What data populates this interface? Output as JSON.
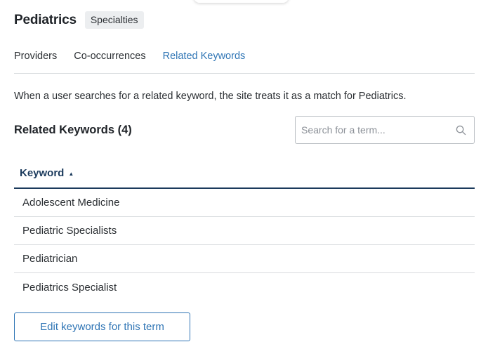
{
  "header": {
    "title": "Pediatrics",
    "badge": "Specialties"
  },
  "tabs": [
    {
      "label": "Providers",
      "active": false
    },
    {
      "label": "Co-occurrences",
      "active": false
    },
    {
      "label": "Related Keywords",
      "active": true
    }
  ],
  "description": "When a user searches for a related keyword, the site treats it as a match for Pediatrics.",
  "section": {
    "heading": "Related Keywords (4)"
  },
  "search": {
    "placeholder": "Search for a term...",
    "value": "",
    "icon": "search-icon"
  },
  "table": {
    "columns": [
      {
        "label": "Keyword",
        "sort": "ascending",
        "sort_icon": "▲"
      }
    ],
    "rows": [
      {
        "keyword": "Adolescent Medicine"
      },
      {
        "keyword": "Pediatric Specialists"
      },
      {
        "keyword": "Pediatrician"
      },
      {
        "keyword": "Pediatrics Specialist"
      }
    ]
  },
  "actions": {
    "edit_label": "Edit keywords for this term"
  },
  "colors": {
    "accent": "#2f75b5",
    "header_text": "#1b3a5c",
    "divider": "#d9dcdf"
  }
}
